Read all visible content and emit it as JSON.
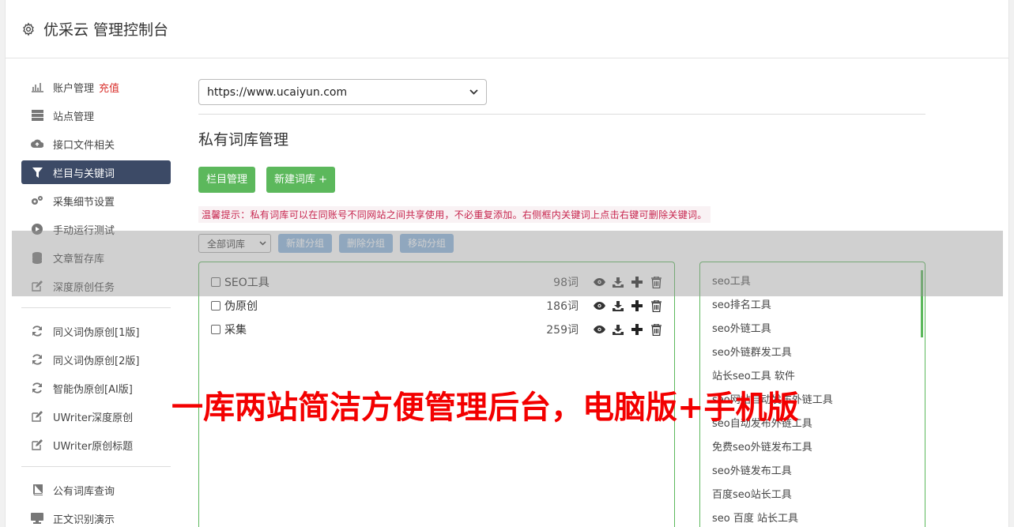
{
  "header": {
    "title": "优采云 管理控制台"
  },
  "sidebar": {
    "group1": [
      {
        "label": "账户管理",
        "badge": "充值",
        "icon": "bar-chart-icon"
      },
      {
        "label": "站点管理",
        "icon": "server-icon"
      },
      {
        "label": "接口文件相关",
        "icon": "cloud-upload-icon"
      },
      {
        "label": "栏目与关键词",
        "icon": "filter-icon",
        "active": true
      },
      {
        "label": "采集细节设置",
        "icon": "gears-icon"
      },
      {
        "label": "手动运行测试",
        "icon": "play-icon"
      },
      {
        "label": "文章暂存库",
        "icon": "database-icon"
      },
      {
        "label": "深度原创任务",
        "icon": "edit-icon"
      }
    ],
    "group2": [
      {
        "label": "同义词伪原创[1版]",
        "icon": "refresh-icon"
      },
      {
        "label": "同义词伪原创[2版]",
        "icon": "refresh-icon"
      },
      {
        "label": "智能伪原创[AI版]",
        "icon": "refresh-icon"
      },
      {
        "label": "UWriter深度原创",
        "icon": "edit-icon"
      },
      {
        "label": "UWriter原创标题",
        "icon": "edit-icon"
      }
    ],
    "group3": [
      {
        "label": "公有词库查询",
        "icon": "book-icon"
      },
      {
        "label": "正文识别演示",
        "icon": "monitor-icon"
      }
    ]
  },
  "main": {
    "site_select": "https://www.ucaiyun.com",
    "heading": "私有词库管理",
    "btn_column": "栏目管理",
    "btn_new_lib": "新建词库 +",
    "tip": "温馨提示：私有词库可以在同账号不同网站之间共享使用，不必重复添加。右侧框内关键词上点击右键可删除关键词。",
    "lib_filter": "全部词库",
    "btn_new_group": "新建分组",
    "btn_del_group": "删除分组",
    "btn_move_group": "移动分组",
    "libraries": [
      {
        "name": "SEO工具",
        "count": "98词"
      },
      {
        "name": "伪原创",
        "count": "186词"
      },
      {
        "name": "采集",
        "count": "259词"
      }
    ],
    "keywords": [
      "seo工具",
      "seo排名工具",
      "seo外链工具",
      "seo外链群发工具",
      "站长seo工具 软件",
      "seo网站自动发布外链工具",
      "seo自动发布外链工具",
      "免费seo外链发布工具",
      "seo外链发布工具",
      "百度seo站长工具",
      "seo 百度 站长工具"
    ]
  },
  "caption": "一库两站简洁方便管理后台，电脑版+手机版",
  "colors": {
    "green": "#5cb85c",
    "nav_active": "#3c4a66",
    "tip_red": "#c7254e",
    "caption_red": "#f30000"
  }
}
